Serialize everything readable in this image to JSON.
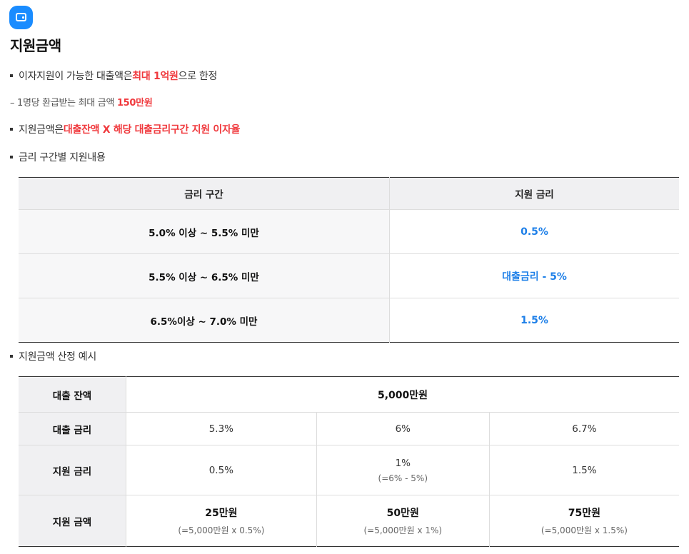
{
  "title": "지원금액",
  "bullets": {
    "b1_prefix": "이자지원이 가능한 대출액은 ",
    "b1_highlight": "최대 1억원",
    "b1_suffix": "으로 한정",
    "d1_prefix": "– 1명당 환급받는 최대 금액 ",
    "d1_highlight": "150만원",
    "b2_prefix": "지원금액은 ",
    "b2_highlight": "대출잔액 X 해당 대출금리구간 지원 이자율",
    "b3": "금리 구간별 지원내용",
    "b4": "지원금액 산정 예시"
  },
  "rate_table": {
    "headers": [
      "금리 구간",
      "지원 금리"
    ],
    "rows": [
      {
        "range": "5.0% 이상 ~ 5.5% 미만",
        "rate": "0.5%"
      },
      {
        "range": "5.5% 이상 ~ 6.5% 미만",
        "rate": "대출금리 - 5%"
      },
      {
        "range": "6.5%이상 ~ 7.0% 미만",
        "rate": "1.5%"
      }
    ]
  },
  "example_table": {
    "balance_label": "대출 잔액",
    "balance_value": "5,000만원",
    "loan_rate_label": "대출 금리",
    "loan_rates": [
      "5.3%",
      "6%",
      "6.7%"
    ],
    "support_rate_label": "지원 금리",
    "support_rates": [
      {
        "value": "0.5%",
        "note": ""
      },
      {
        "value": "1%",
        "note": "(=6% - 5%)"
      },
      {
        "value": "1.5%",
        "note": ""
      }
    ],
    "support_amount_label": "지원 금액",
    "support_amounts": [
      {
        "value": "25만원",
        "note": "(=5,000만원 x 0.5%)"
      },
      {
        "value": "50만원",
        "note": "(=5,000만원 x 1%)"
      },
      {
        "value": "75만원",
        "note": "(=5,000만원 x 1.5%)"
      }
    ]
  },
  "colors": {
    "accent_red": "#f0393d",
    "accent_blue": "#1d7fe8",
    "logo_blue": "#1a8cff"
  },
  "icons": {
    "logo": "wallet-icon"
  }
}
